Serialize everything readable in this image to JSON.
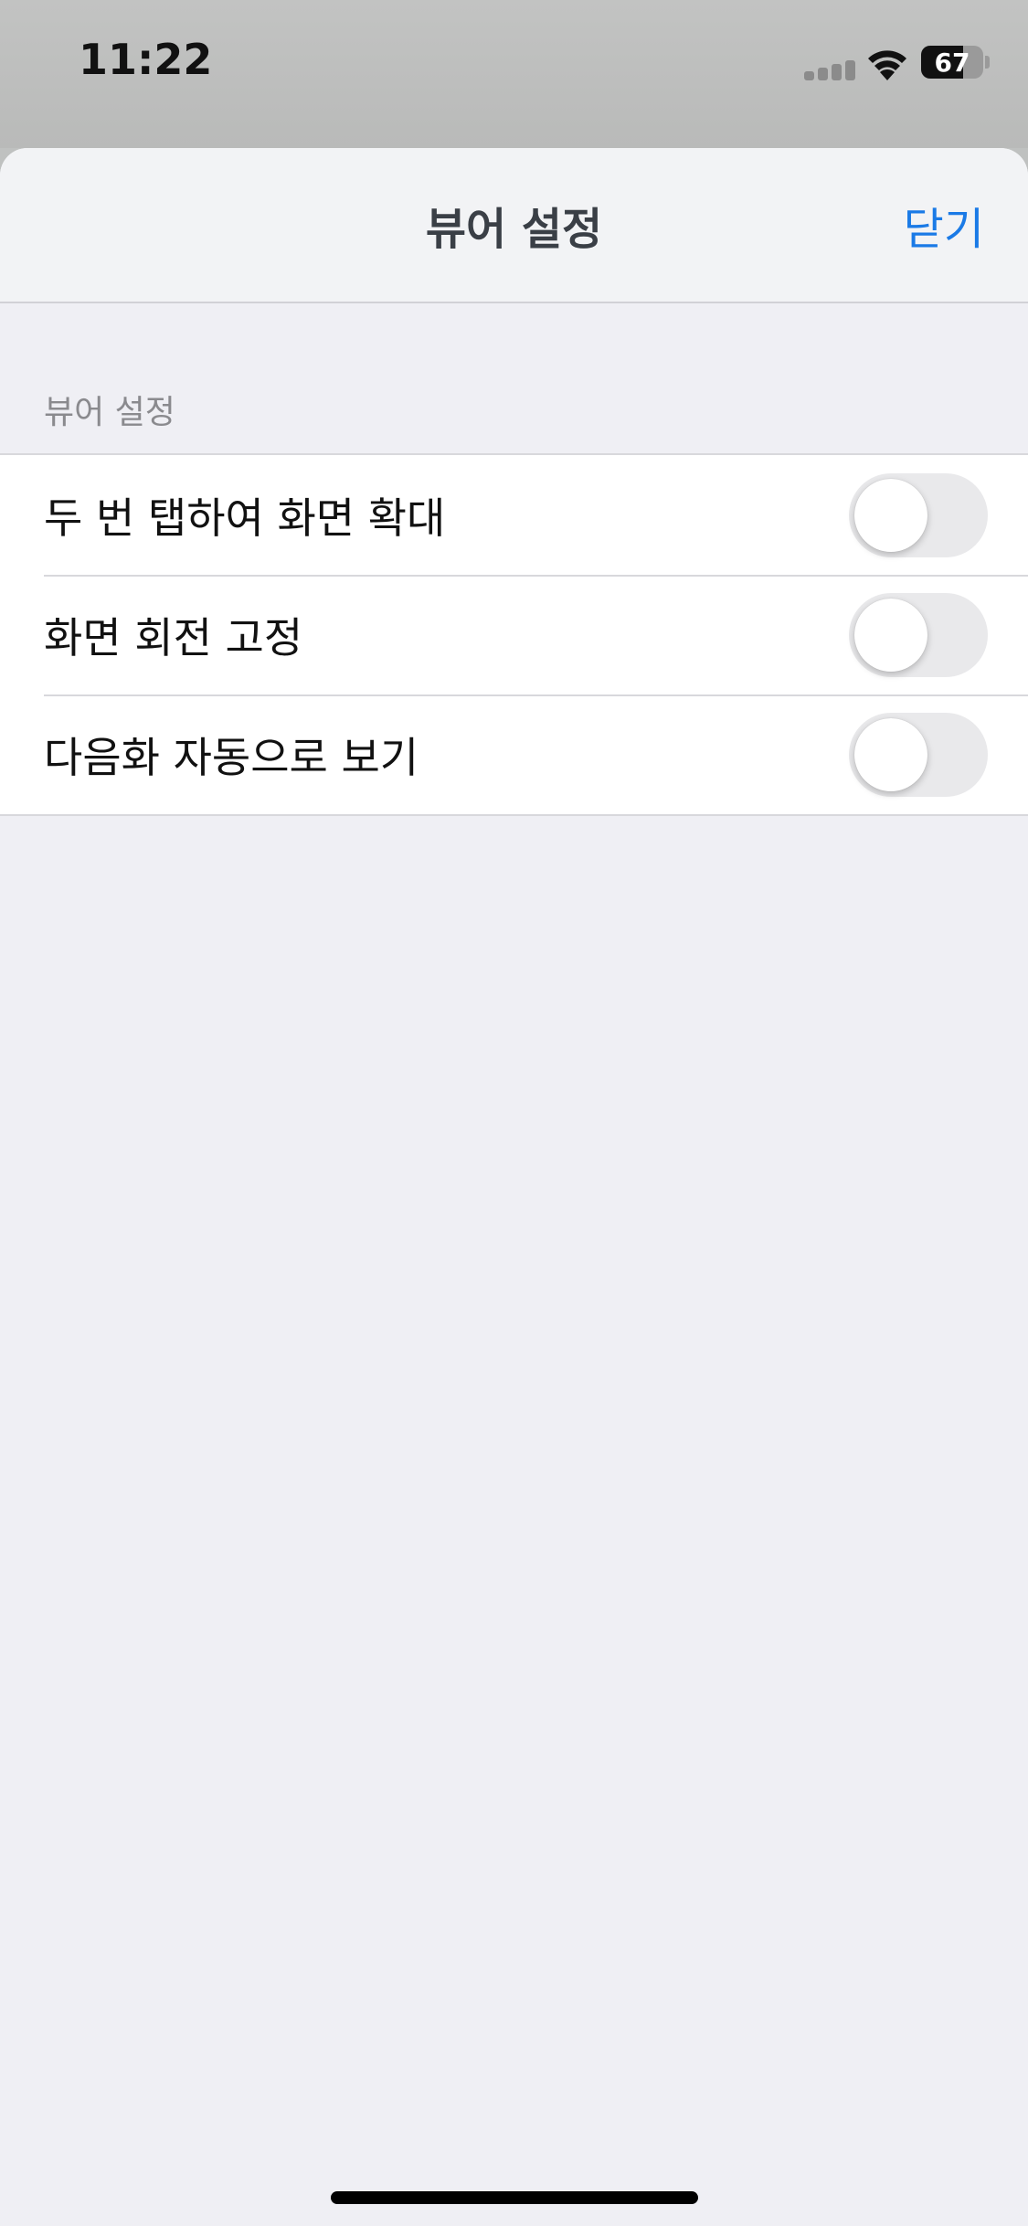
{
  "status_bar": {
    "time": "11:22",
    "battery_percent": 67,
    "battery_label": "67"
  },
  "nav": {
    "title": "뷰어 설정",
    "close_label": "닫기"
  },
  "section": {
    "header": "뷰어 설정",
    "items": [
      {
        "label": "두 번 탭하여 화면 확대",
        "on": false
      },
      {
        "label": "화면 회전 고정",
        "on": false
      },
      {
        "label": "다음화 자동으로 보기",
        "on": false
      }
    ]
  },
  "colors": {
    "accent": "#1a7ae6",
    "toggle_off": "#e9e9eb",
    "background": "#efeff4"
  }
}
